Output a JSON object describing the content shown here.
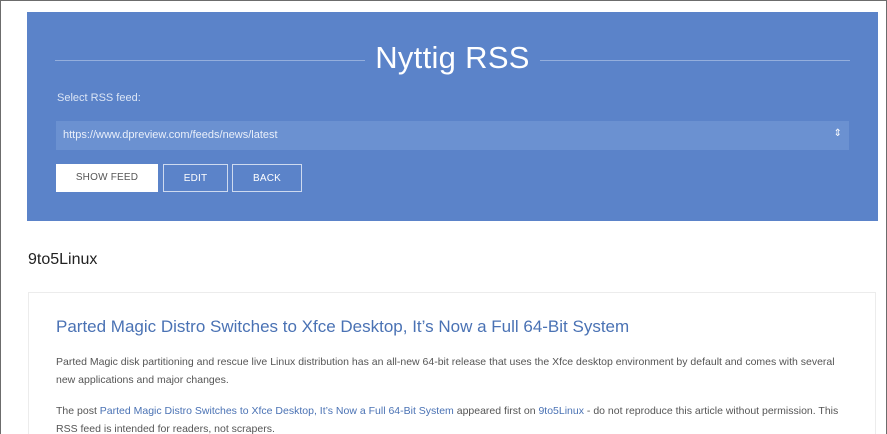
{
  "app": {
    "title": "Nyttig RSS"
  },
  "feed_selector": {
    "label": "Select RSS feed:",
    "selected_value": "https://www.dpreview.com/feeds/news/latest"
  },
  "buttons": {
    "show_feed": "SHOW FEED",
    "edit": "EDIT",
    "back": "BACK"
  },
  "feed": {
    "name": "9to5Linux"
  },
  "article": {
    "title": "Parted Magic Distro Switches to Xfce Desktop, It’s Now a Full 64-Bit System",
    "summary": "Parted Magic disk partitioning and rescue live Linux distribution has an all-new 64-bit release that uses the Xfce desktop environment by default and comes with several new applications and major changes.",
    "footer_prefix": "The post ",
    "footer_post_link": "Parted Magic Distro Switches to Xfce Desktop, It’s Now a Full 64-Bit System",
    "footer_mid": " appeared first on ",
    "footer_site_link": "9to5Linux",
    "footer_suffix": " - do not reproduce this article without permission. This RSS feed is intended for readers, not scrapers."
  },
  "colors": {
    "hero_background": "#5b83c9",
    "link": "#4a72b4"
  },
  "icons": {
    "select_caret": "up-down-caret-icon"
  }
}
